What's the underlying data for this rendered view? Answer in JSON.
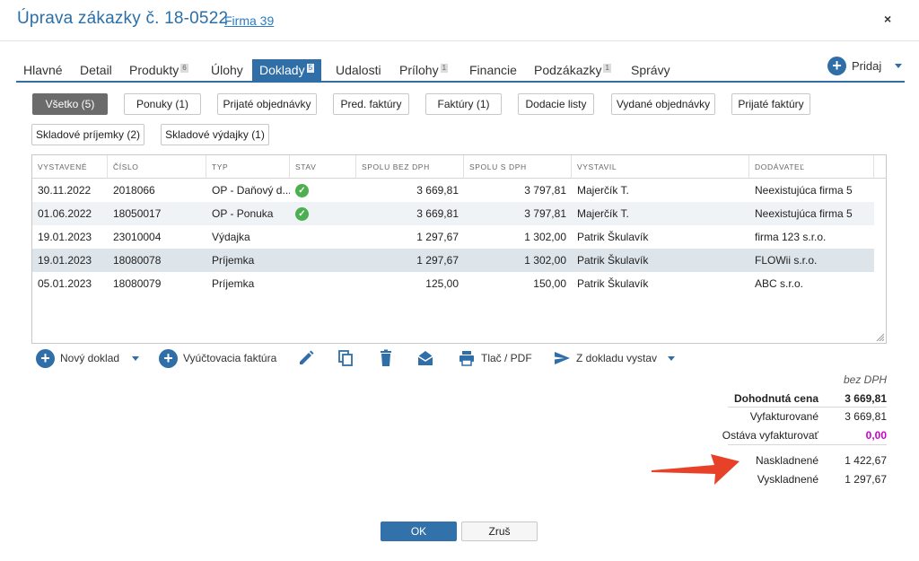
{
  "header": {
    "title": "Úprava zákazky č. 18-0522",
    "client_link": "Firma 39",
    "close": "×"
  },
  "tabs": [
    {
      "label": "Hlavné",
      "count": ""
    },
    {
      "label": "Detail",
      "count": ""
    },
    {
      "label": "Produkty",
      "count": "6"
    },
    {
      "label": "Úlohy",
      "count": ""
    },
    {
      "label": "Doklady",
      "count": "5",
      "active": true
    },
    {
      "label": "Udalosti",
      "count": ""
    },
    {
      "label": "Prílohy",
      "count": "1"
    },
    {
      "label": "Financie",
      "count": ""
    },
    {
      "label": "Podzákazky",
      "count": "1"
    },
    {
      "label": "Správy",
      "count": ""
    }
  ],
  "add_menu": {
    "label": "Pridaj"
  },
  "filters": [
    {
      "label": "Všetko (5)",
      "selected": true
    },
    {
      "label": "Ponuky (1)"
    },
    {
      "label": "Prijaté objednávky"
    },
    {
      "label": "Pred. faktúry"
    },
    {
      "label": "Faktúry (1)"
    },
    {
      "label": "Dodacie listy"
    },
    {
      "label": "Vydané objednávky"
    },
    {
      "label": "Prijaté faktúry"
    },
    {
      "label": "Skladové príjemky (2)"
    },
    {
      "label": "Skladové výdajky (1)"
    }
  ],
  "table": {
    "columns": [
      "VYSTAVENÉ",
      "ČÍSLO",
      "TYP",
      "STAV",
      "SPOLU BEZ DPH",
      "SPOLU S DPH",
      "VYSTAVIL",
      "DODÁVATEĽ"
    ],
    "rows": [
      {
        "date": "30.11.2022",
        "number": "2018066",
        "type": "OP - Daňový d...",
        "status_ok": true,
        "net": "3 669,81",
        "gross": "3 797,81",
        "issuer": "Majerčík T.",
        "supplier": "Neexistujúca firma 5"
      },
      {
        "date": "01.06.2022",
        "number": "18050017",
        "type": "OP - Ponuka",
        "status_ok": true,
        "net": "3 669,81",
        "gross": "3 797,81",
        "issuer": "Majerčík T.",
        "supplier": "Neexistujúca firma 5"
      },
      {
        "date": "19.01.2023",
        "number": "23010004",
        "type": "Výdajka",
        "status_ok": false,
        "net": "1 297,67",
        "gross": "1 302,00",
        "issuer": "Patrik Škulavík",
        "supplier": "firma 123 s.r.o."
      },
      {
        "date": "19.01.2023",
        "number": "18080078",
        "type": "Príjemka",
        "status_ok": false,
        "net": "1 297,67",
        "gross": "1 302,00",
        "issuer": "Patrik Škulavík",
        "supplier": "FLOWii s.r.o."
      },
      {
        "date": "05.01.2023",
        "number": "18080079",
        "type": "Príjemka",
        "status_ok": false,
        "net": "125,00",
        "gross": "150,00",
        "issuer": "Patrik Škulavík",
        "supplier": "ABC s.r.o."
      }
    ]
  },
  "toolbar": {
    "new_doc": "Nový doklad",
    "billing_invoice": "Vyúčtovacia faktúra",
    "print": "Tlač / PDF",
    "create_from": "Z dokladu vystav"
  },
  "summary": {
    "note": "bez DPH",
    "agreed_price_label": "Dohodnutá cena",
    "agreed_price": "3 669,81",
    "invoiced_label": "Vyfakturované",
    "invoiced": "3 669,81",
    "remaining_label": "Ostáva vyfakturovať",
    "remaining": "0,00",
    "remaining_color": "#cc00cc",
    "stocked_in_label": "Naskladnené",
    "stocked_in": "1 422,67",
    "stocked_out_label": "Vyskladnené",
    "stocked_out": "1 297,67"
  },
  "footer": {
    "ok": "OK",
    "cancel": "Zruš"
  },
  "colors": {
    "accent": "#2f6ea6",
    "arrow": "#e8412a",
    "status_ok": "#4caf50"
  }
}
